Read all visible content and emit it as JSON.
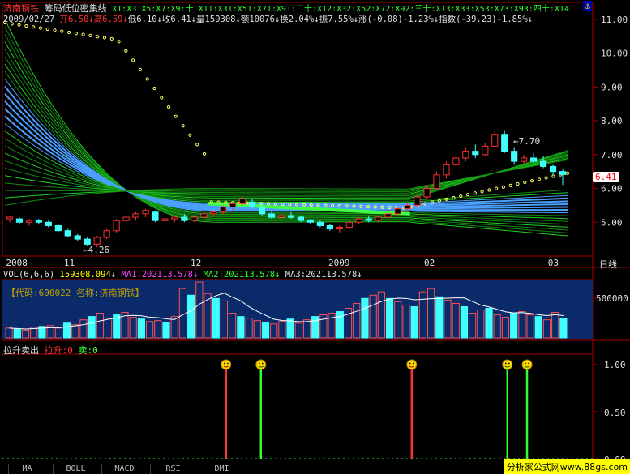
{
  "header": {
    "stock_name": "济南钢铁",
    "indicator_name": "筹码低位密集线",
    "ma_labels": "X1:X3:X5:X7:X9:十 X11:X31:X51:X71:X91:二十:X12:X32:X52:X72:X92:三十:X13:X33:X53:X73:X93:四十:X14",
    "lock_icon": "⚓"
  },
  "quote": {
    "date": "2009/02/27",
    "open_label": "开",
    "open": "6.50",
    "high_label": "高",
    "high": "6.59",
    "low_label": "低",
    "low": "6.10",
    "close_label": "收",
    "close": "6.41",
    "volume_label": "量",
    "volume": "159308",
    "amount_label": "额",
    "amount": "10076",
    "turnover_label": "换",
    "turnover": "2.04%",
    "amplitude_label": "振",
    "amplitude": "7.55%",
    "change_label": "涨",
    "change": "(-0.08)-1.23%",
    "index_label": "指数",
    "index_change": "(-39.23)-1.85%"
  },
  "price_axis": [
    "11.00",
    "10.00",
    "9.00",
    "8.00",
    "7.00",
    "6.00",
    "5.00"
  ],
  "price_marker": "6.41",
  "annotations": {
    "high": "7.70",
    "low": "4.26"
  },
  "time_axis": {
    "labels": [
      "2008",
      "11",
      "12",
      "2009",
      "02",
      "03"
    ],
    "period": "日线"
  },
  "volume": {
    "title": "VOL(6,6,6)",
    "value": "159308.094",
    "ma1_label": "MA1:",
    "ma1": "202113.578",
    "ma2_label": "MA2:",
    "ma2": "202113.578",
    "ma3_label": "MA3:",
    "ma3": "202113.578",
    "info": "【代码:600022  名称:济南钢铁】",
    "axis": "500000"
  },
  "signal": {
    "title": "拉升卖出",
    "up_label": "拉升:",
    "up_value": "0",
    "sell_label": "卖:",
    "sell_value": "0",
    "axis": [
      "1.00",
      "0.50",
      "0.00"
    ]
  },
  "tabs": [
    "MA",
    "BOLL",
    "MACD",
    "RSI",
    "DMI"
  ],
  "watermark": "分析家公式网www.88gs.com",
  "chart_data": [
    {
      "type": "candlestick",
      "title": "济南钢铁",
      "y_range": [
        4.0,
        11.5
      ],
      "candles": [
        [
          5.1,
          5.2,
          5.0,
          5.15
        ],
        [
          5.1,
          5.15,
          4.95,
          5.0
        ],
        [
          5.0,
          5.1,
          4.9,
          5.05
        ],
        [
          5.05,
          5.1,
          4.95,
          5.0
        ],
        [
          5.0,
          5.05,
          4.85,
          4.9
        ],
        [
          4.9,
          4.95,
          4.7,
          4.75
        ],
        [
          4.75,
          4.8,
          4.55,
          4.6
        ],
        [
          4.6,
          4.65,
          4.45,
          4.5
        ],
        [
          4.5,
          4.55,
          4.3,
          4.35
        ],
        [
          4.35,
          4.6,
          4.26,
          4.55
        ],
        [
          4.55,
          4.8,
          4.5,
          4.75
        ],
        [
          4.75,
          5.1,
          4.7,
          5.05
        ],
        [
          5.05,
          5.2,
          4.95,
          5.15
        ],
        [
          5.15,
          5.3,
          5.05,
          5.25
        ],
        [
          5.25,
          5.4,
          5.15,
          5.35
        ],
        [
          5.3,
          5.35,
          5.0,
          5.05
        ],
        [
          5.05,
          5.15,
          4.95,
          5.1
        ],
        [
          5.1,
          5.2,
          5.0,
          5.15
        ],
        [
          5.15,
          5.25,
          5.0,
          5.05
        ],
        [
          5.05,
          5.2,
          5.0,
          5.15
        ],
        [
          5.15,
          5.3,
          5.1,
          5.25
        ],
        [
          5.25,
          5.35,
          5.15,
          5.3
        ],
        [
          5.3,
          5.5,
          5.25,
          5.45
        ],
        [
          5.45,
          5.6,
          5.35,
          5.55
        ],
        [
          5.55,
          5.75,
          5.5,
          5.7
        ],
        [
          5.6,
          5.7,
          5.4,
          5.45
        ],
        [
          5.45,
          5.55,
          5.2,
          5.25
        ],
        [
          5.25,
          5.35,
          5.1,
          5.15
        ],
        [
          5.15,
          5.25,
          5.05,
          5.2
        ],
        [
          5.2,
          5.3,
          5.1,
          5.15
        ],
        [
          5.15,
          5.2,
          5.0,
          5.05
        ],
        [
          5.05,
          5.1,
          4.95,
          5.0
        ],
        [
          5.0,
          5.05,
          4.85,
          4.9
        ],
        [
          4.9,
          4.95,
          4.75,
          4.8
        ],
        [
          4.8,
          4.9,
          4.7,
          4.85
        ],
        [
          4.85,
          5.05,
          4.8,
          5.0
        ],
        [
          5.0,
          5.15,
          4.95,
          5.1
        ],
        [
          5.1,
          5.2,
          5.0,
          5.05
        ],
        [
          5.05,
          5.2,
          5.0,
          5.15
        ],
        [
          5.15,
          5.3,
          5.1,
          5.25
        ],
        [
          5.25,
          5.45,
          5.2,
          5.4
        ],
        [
          5.4,
          5.55,
          5.3,
          5.5
        ],
        [
          5.5,
          5.8,
          5.45,
          5.75
        ],
        [
          5.75,
          6.1,
          5.7,
          6.0
        ],
        [
          6.0,
          6.5,
          5.95,
          6.4
        ],
        [
          6.4,
          6.8,
          6.3,
          6.7
        ],
        [
          6.7,
          7.0,
          6.6,
          6.9
        ],
        [
          6.9,
          7.2,
          6.8,
          7.1
        ],
        [
          7.1,
          7.3,
          6.9,
          7.0
        ],
        [
          7.0,
          7.35,
          6.95,
          7.25
        ],
        [
          7.25,
          7.7,
          7.2,
          7.6
        ],
        [
          7.6,
          7.7,
          7.05,
          7.1
        ],
        [
          7.1,
          7.2,
          6.7,
          6.8
        ],
        [
          6.8,
          7.0,
          6.7,
          6.9
        ],
        [
          6.9,
          7.05,
          6.75,
          6.8
        ],
        [
          6.8,
          6.95,
          6.6,
          6.65
        ],
        [
          6.65,
          6.7,
          6.4,
          6.5
        ],
        [
          6.5,
          6.59,
          6.1,
          6.41
        ]
      ]
    },
    {
      "type": "bar",
      "title": "VOL(6,6,6)",
      "y_range": [
        0,
        700000
      ],
      "values": [
        120000,
        110000,
        95000,
        130000,
        140000,
        150000,
        120000,
        180000,
        160000,
        220000,
        260000,
        300000,
        240000,
        280000,
        310000,
        250000,
        230000,
        200000,
        210000,
        190000,
        260000,
        600000,
        520000,
        680000,
        540000,
        480000,
        450000,
        300000,
        260000,
        240000,
        210000,
        190000,
        170000,
        200000,
        230000,
        180000,
        220000,
        260000,
        280000,
        300000,
        320000,
        360000,
        420000,
        480000,
        520000,
        560000,
        480000,
        440000,
        400000,
        380000,
        560000,
        600000,
        500000,
        460000,
        420000,
        380000,
        300000,
        340000,
        360000,
        280000,
        250000,
        300000,
        320000,
        280000,
        260000,
        220000,
        310000,
        240000
      ]
    },
    {
      "type": "bar",
      "title": "拉升卖出",
      "y_range": [
        0,
        1.0
      ],
      "series": [
        {
          "name": "拉升",
          "x_fraction": [
            0.393,
            0.723
          ],
          "values": [
            1,
            1
          ]
        },
        {
          "name": "卖",
          "x_fraction": [
            0.455,
            0.893,
            0.928
          ],
          "values": [
            1,
            1,
            1
          ]
        }
      ]
    }
  ]
}
